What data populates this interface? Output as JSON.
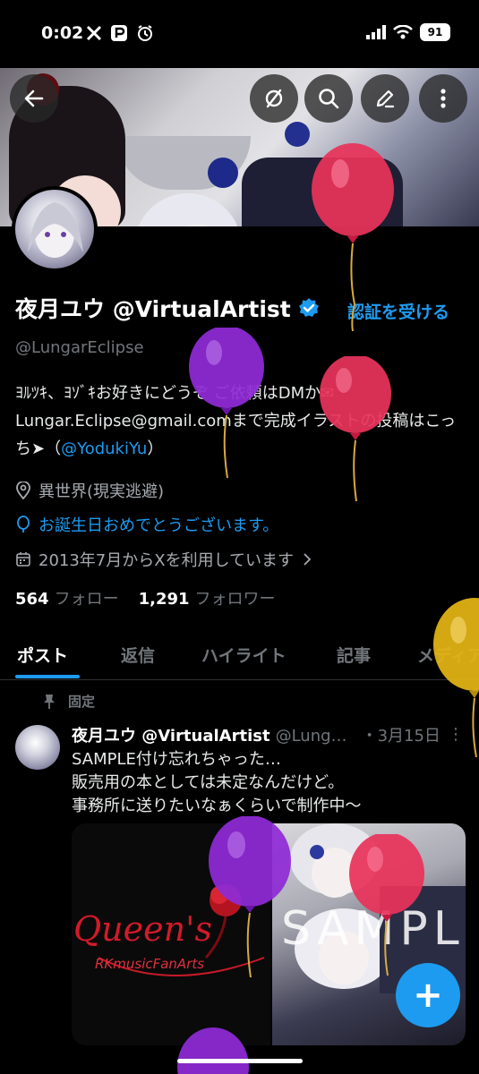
{
  "status": {
    "time": "0:02",
    "battery": "91",
    "app_icons": [
      "x-icon",
      "p-icon",
      "alarm-icon"
    ]
  },
  "banner": {
    "buttons": [
      "back-icon",
      "translate-off-icon",
      "search-icon",
      "edit-icon",
      "more-icon"
    ]
  },
  "profile": {
    "display_name": "夜月ユウ @VirtualArtist",
    "verify_link": "認証を受ける",
    "handle": "@LungarEclipse",
    "bio_text": "ﾖﾙﾂｷ、ﾖｿﾞｷお好きにどうぞ ご依頼はDMか✉Lungar.Eclipse@gmail.comまで完成イラストの投稿はこっち➤（",
    "bio_mention": "@YodukiYu",
    "bio_close": "）",
    "location": "異世界(現実逃避)",
    "birthday": "お誕生日おめでとうございます。",
    "joined": "2013年7月からXを利用しています",
    "following_count": "564",
    "following_label": "フォロー",
    "followers_count": "1,291",
    "followers_label": "フォロワー"
  },
  "tabs": [
    {
      "label": "ポスト",
      "active": true
    },
    {
      "label": "返信",
      "active": false
    },
    {
      "label": "ハイライト",
      "active": false
    },
    {
      "label": "記事",
      "active": false
    },
    {
      "label": "メディア",
      "active": false
    }
  ],
  "post": {
    "pinned_label": "固定",
    "name": "夜月ユウ @VirtualArtist",
    "handle": "@LungarEclipse",
    "date": "・3月15日",
    "more": "⋮",
    "text_lines": [
      "SAMPLE付け忘れちゃった…",
      "販売用の本としては未定なんだけど。",
      "事務所に送りたいなぁくらいで制作中〜"
    ],
    "media_left_script": "Queen's",
    "media_left_sub": "RKmusicFanArts",
    "media_right_text": "SAMPL"
  },
  "fab": {
    "label": "+"
  },
  "colors": {
    "accent": "#1d9bf0",
    "background": "#000000",
    "text": "#e7e9ea",
    "secondary_text": "#71767b",
    "balloon_red": "#e8335a",
    "balloon_purple": "#8f2bd6",
    "balloon_yellow": "#e3b514"
  }
}
